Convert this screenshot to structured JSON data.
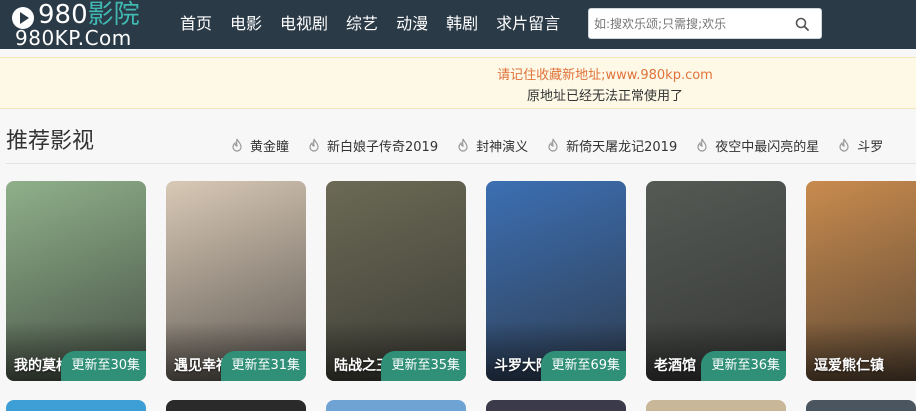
{
  "logo": {
    "top_text": "980",
    "top_accent": "影院",
    "bottom_text": "980KP.Com"
  },
  "nav": [
    "首页",
    "电影",
    "电视剧",
    "综艺",
    "动漫",
    "韩剧",
    "求片留言"
  ],
  "search": {
    "placeholder": "如:搜欢乐颂;只需搜;欢乐"
  },
  "notice": {
    "line1": "请记住收藏新地址;www.980kp.com",
    "line2": "原地址已经无法正常使用了"
  },
  "section": {
    "title": "推荐影视",
    "hot": [
      "黄金瞳",
      "新白娘子传奇2019",
      "封神演义",
      "新倚天屠龙记2019",
      "夜空中最闪亮的星",
      "斗罗"
    ]
  },
  "cards": [
    {
      "title": "我的莫格",
      "badge": "更新至30集",
      "color": "#8fb08a"
    },
    {
      "title": "遇见幸福",
      "badge": "更新至31集",
      "color": "#d9c9b6"
    },
    {
      "title": "陆战之王",
      "badge": "更新至35集",
      "color": "#6b6a55"
    },
    {
      "title": "斗罗大陆",
      "badge": "更新至69集",
      "color": "#3c6fb3"
    },
    {
      "title": "老酒馆",
      "badge": "更新至36集",
      "color": "#555a55"
    },
    {
      "title": "逗爱熊仁镇",
      "badge": "",
      "color": "#c98b4e"
    }
  ],
  "row2_colors": [
    "#3d9fd6",
    "#2a2a2a",
    "#6fa3d4",
    "#3a3a4a",
    "#c9b79a",
    "#4a5560"
  ]
}
